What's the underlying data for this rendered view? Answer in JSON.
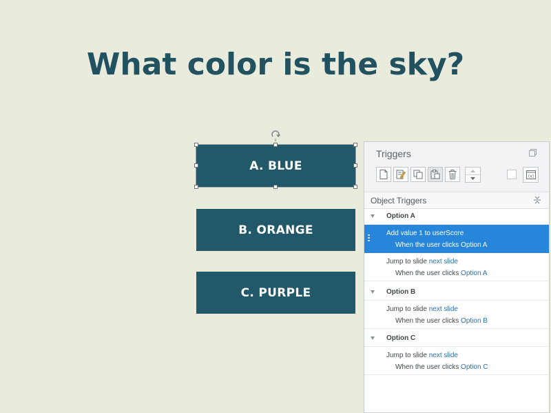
{
  "slide": {
    "question": "What color is the sky?",
    "options": [
      "A. BLUE",
      "B. ORANGE",
      "C. PURPLE"
    ]
  },
  "triggers_panel": {
    "title": "Triggers",
    "section": "Object Triggers",
    "toolbar_icons": [
      "new-trigger-icon",
      "edit-trigger-icon",
      "copy-icon",
      "paste-icon",
      "delete-icon",
      "move-up-icon",
      "move-down-icon",
      "variables-icon"
    ],
    "groups": [
      {
        "name": "Option A",
        "triggers": [
          {
            "action_prefix": "Add value 1 to userScore",
            "action_link": "",
            "event_prefix": "When the user clicks",
            "event_link": "Option A",
            "selected": true
          },
          {
            "action_prefix": "Jump to slide",
            "action_link": "next slide",
            "event_prefix": "When the user clicks",
            "event_link": "Option A",
            "selected": false
          }
        ]
      },
      {
        "name": "Option B",
        "triggers": [
          {
            "action_prefix": "Jump to slide",
            "action_link": "next slide",
            "event_prefix": "When the user clicks",
            "event_link": "Option B",
            "selected": false
          }
        ]
      },
      {
        "name": "Option C",
        "triggers": [
          {
            "action_prefix": "Jump to slide",
            "action_link": "next slide",
            "event_prefix": "When the user clicks",
            "event_link": "Option C",
            "selected": false
          }
        ]
      }
    ]
  },
  "colors": {
    "background": "#e9ecdd",
    "title": "#22525f",
    "button": "#22596a",
    "selection": "#2786d9",
    "link": "#2b6fae"
  }
}
